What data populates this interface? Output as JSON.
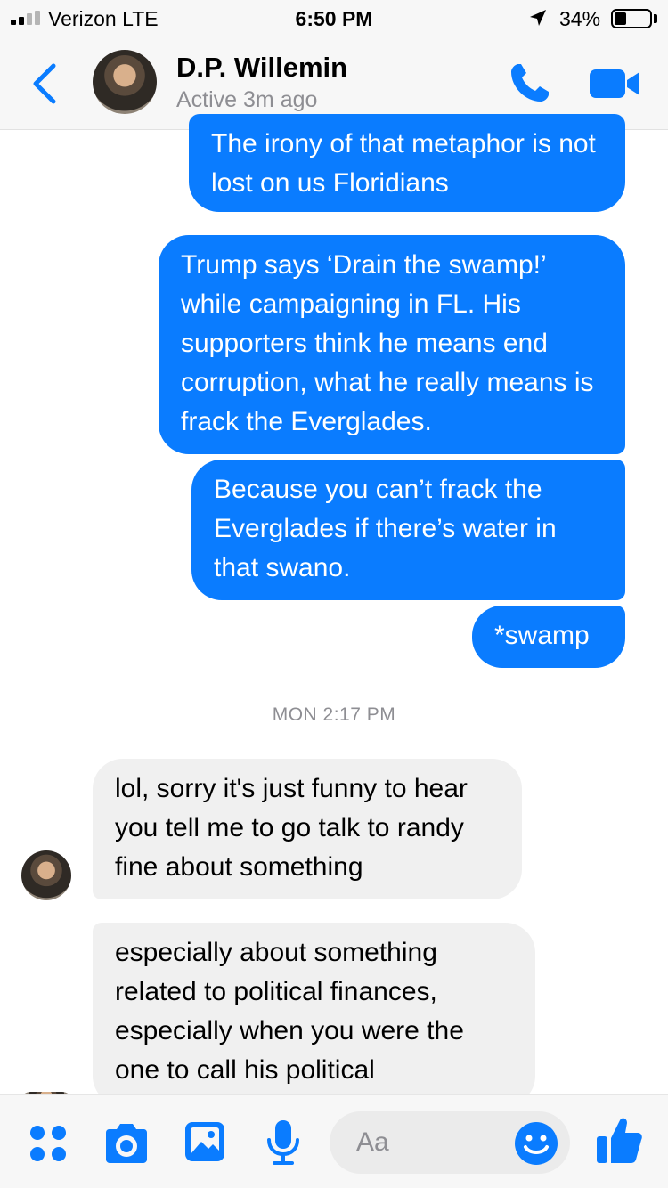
{
  "status_bar": {
    "carrier": "Verizon  LTE",
    "time": "6:50 PM",
    "battery": "34%",
    "battery_level": 0.34
  },
  "header": {
    "name": "D.P. Willemin",
    "status": "Active 3m ago",
    "icons": [
      "back-chevron-icon",
      "phone-icon",
      "video-camera-icon"
    ]
  },
  "messages": {
    "m1": "The irony of that metaphor is not lost on us Floridians",
    "m2": "Trump says ‘Drain the swamp!’ while campaigning in FL. His supporters think he means end corruption, what he really means is frack the Everglades.",
    "m3": "Because you can’t frack the Everglades if there’s water in that swano.",
    "m4": "*swamp",
    "timestamp": "MON 2:17 PM",
    "m5": "lol, sorry it's just funny to hear you tell me to go talk to randy fine about something",
    "m6": "especially about something related to political finances, especially when you were the one to call his political"
  },
  "composer": {
    "placeholder": "Aa",
    "icons": [
      "apps-icon",
      "camera-icon",
      "gallery-icon",
      "microphone-icon",
      "emoji-icon",
      "thumbs-up-icon"
    ]
  },
  "colors": {
    "accent": "#0a7cff",
    "incoming_bubble": "#f0f0f0",
    "secondary_text": "#8e8e93"
  }
}
